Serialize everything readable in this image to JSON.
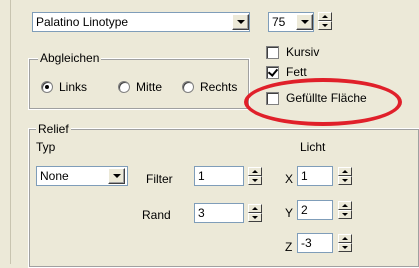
{
  "font": {
    "family_value": "Palatino Linotype",
    "size_value": "75"
  },
  "align": {
    "group_title": "Abgleichen",
    "options": [
      "Links",
      "Mitte",
      "Rechts"
    ],
    "selected": "Links"
  },
  "style": {
    "kursiv": "Kursiv",
    "fett": "Fett",
    "gefuellte": "Gefüllte Fläche",
    "kursiv_checked": false,
    "fett_checked": true,
    "gefuellte_checked": false
  },
  "relief": {
    "group_title": "Relief",
    "typ_label": "Typ",
    "typ_value": "None",
    "filter_label": "Filter",
    "filter_value": "1",
    "rand_label": "Rand",
    "rand_value": "3",
    "licht_label": "Licht",
    "x_label": "X",
    "x_value": "1",
    "y_label": "Y",
    "y_value": "2",
    "z_label": "Z",
    "z_value": "-3"
  },
  "annotation": {
    "color": "#e0202a"
  }
}
